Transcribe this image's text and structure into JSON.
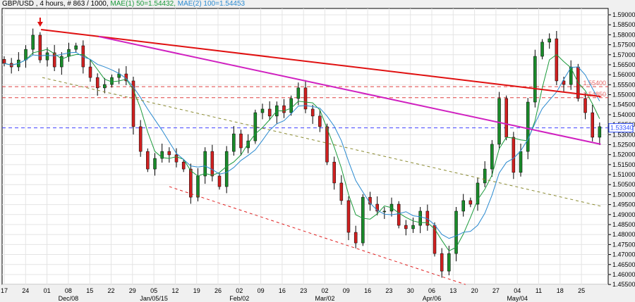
{
  "header": {
    "symbol": "GBP/USD , 4 hours, # 863 / 1000, ",
    "ma1": "MAE(1) 50=1.54432,",
    "ma2": "MAE(2) 100=1.54453"
  },
  "chart_data": {
    "type": "candlestick",
    "title": "GBP/USD , 4 hours",
    "ylim": [
      1.455,
      1.59
    ],
    "y_ticks": [
      "1.59000",
      "1.58500",
      "1.58000",
      "1.57500",
      "1.57000",
      "1.56500",
      "1.56000",
      "1.55500",
      "1.55000",
      "1.54500",
      "1.54000",
      "1.53500",
      "1.53000",
      "1.52500",
      "1.52000",
      "1.51500",
      "1.51000",
      "1.50500",
      "1.50000",
      "1.49500",
      "1.49000",
      "1.48500",
      "1.48000",
      "1.47500",
      "1.47000",
      "1.46500",
      "1.46000",
      "1.45500"
    ],
    "x_ticks": [
      "17",
      "24",
      "01",
      "08",
      "15",
      "22",
      "29",
      "05",
      "12",
      "19",
      "26",
      "02",
      "09",
      "16",
      "23",
      "02",
      "09",
      "16",
      "23",
      "30",
      "06",
      "13",
      "20",
      "27",
      "04",
      "11",
      "18",
      "25"
    ],
    "x_month_labels": [
      {
        "week": 3,
        "label": "Dec/08"
      },
      {
        "week": 7,
        "label": "Jan/05/15"
      },
      {
        "week": 11,
        "label": "Feb/02"
      },
      {
        "week": 15,
        "label": "Mar/02"
      },
      {
        "week": 20,
        "label": "Apr/06"
      },
      {
        "week": 24,
        "label": "May/04"
      }
    ],
    "x_unit": "weeks since Nov 17",
    "closes": [
      1.5657,
      1.5639,
      1.5674,
      1.5727,
      1.5798,
      1.5674,
      1.571,
      1.5639,
      1.5692,
      1.5727,
      1.5745,
      1.5639,
      1.5586,
      1.5534,
      1.5551,
      1.5586,
      1.5604,
      1.5569,
      1.534,
      1.5216,
      1.5128,
      1.5181,
      1.5216,
      1.5199,
      1.5163,
      1.5128,
      1.4987,
      1.5093,
      1.5216,
      1.5093,
      1.504,
      1.5216,
      1.5304,
      1.5234,
      1.5269,
      1.541,
      1.5428,
      1.5393,
      1.5445,
      1.541,
      1.5481,
      1.5534,
      1.5428,
      1.5393,
      1.534,
      1.5163,
      1.5058,
      1.497,
      1.4811,
      1.4758,
      1.4987,
      1.4952,
      1.4917,
      1.4917,
      1.4952,
      1.4846,
      1.4829,
      1.4846,
      1.4917,
      1.4846,
      1.4705,
      1.4617,
      1.4705,
      1.4917,
      1.497,
      1.4952,
      1.5058,
      1.5128,
      1.5252,
      1.5481,
      1.5287,
      1.5111,
      1.5216,
      1.5463,
      1.5692,
      1.5763,
      1.578,
      1.5569,
      1.5551,
      1.5639,
      1.5481,
      1.541,
      1.5287,
      1.534
    ],
    "ma_periods": [
      50,
      100
    ],
    "trendlines": [
      {
        "name": "resistance",
        "color": "#e01010",
        "style": "solid",
        "p1": [
          1.72,
          1.5826
        ],
        "p2": [
          27.9,
          1.5491
        ]
      },
      {
        "name": "channel",
        "color": "#d020c0",
        "style": "solid",
        "p1": [
          4.42,
          1.5791
        ],
        "p2": [
          27.9,
          1.5252
        ]
      },
      {
        "name": "olive-trend",
        "color": "#8a8a30",
        "style": "dashed",
        "p1": [
          1.78,
          1.5586
        ],
        "p2": [
          27.9,
          1.4942
        ]
      },
      {
        "name": "lower-support",
        "color": "#e02020",
        "style": "dashed",
        "p1": [
          7.72,
          1.504
        ],
        "p2": [
          21.58,
          1.455
        ]
      }
    ],
    "hlines": [
      {
        "price": 1.554,
        "label": "1.55400",
        "color": "#e04040"
      },
      {
        "price": 1.5485,
        "label": "1.54850",
        "color": "#e04040"
      },
      {
        "price": 1.5334,
        "label": "",
        "color": "#4040ff"
      }
    ],
    "current_price": "1.53340",
    "marker": {
      "type": "arrow-down",
      "week": 1.68,
      "color": "#e01010"
    }
  }
}
